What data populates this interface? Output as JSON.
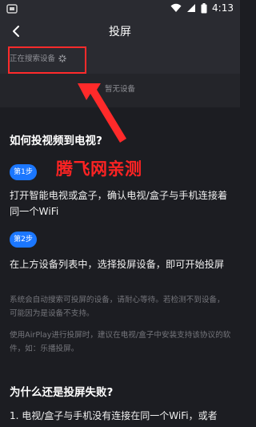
{
  "status_bar": {
    "time": "4:13"
  },
  "nav": {
    "title": "投屏"
  },
  "search": {
    "label": "正在搜索设备"
  },
  "devices": {
    "empty_label": "暂无设备"
  },
  "howto": {
    "title": "如何投视频到电视?",
    "step1": {
      "badge": "第1步",
      "text": "打开智能电视或盒子，确认电视/盒子与手机连接着同一个WiFi"
    },
    "step2": {
      "badge": "第2步",
      "text": "在上方设备列表中，选择投屏设备，即可开始投屏"
    },
    "note1": "系统会自动搜索可投屏的设备，请耐心等待。若检测不到设备，可能因为是设备不支持。",
    "note2": "使用AirPlay进行投屏时，建议在电视/盒子中安装支持该协议的软件，如：乐播投屏。"
  },
  "watermark": "腾飞网亲测",
  "fail": {
    "title": "为什么还是投屏失败?",
    "item1": "1. 电视/盒子与手机没有连接在同一个WiFi，或者"
  }
}
